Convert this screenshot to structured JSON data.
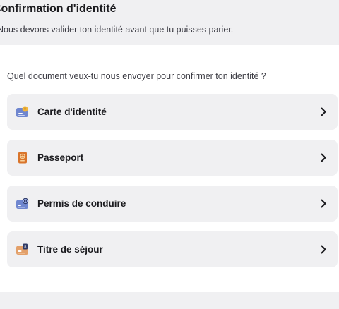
{
  "header": {
    "title": "Confirmation d'identité",
    "subtitle": "Nous devons valider ton identité avant que tu puisses parier."
  },
  "main": {
    "question": "Quel document veux-tu nous envoyer pour confirmer ton identité ?",
    "documents": [
      {
        "label": "Carte d'identité",
        "icon": "id-card-icon"
      },
      {
        "label": "Passeport",
        "icon": "passport-icon"
      },
      {
        "label": "Permis de conduire",
        "icon": "driving-license-icon"
      },
      {
        "label": "Titre de séjour",
        "icon": "residence-permit-icon"
      }
    ]
  },
  "colors": {
    "card_background": "#f0f0f2",
    "text_primary": "#1b1b1f",
    "text_secondary": "#3c3c44"
  }
}
